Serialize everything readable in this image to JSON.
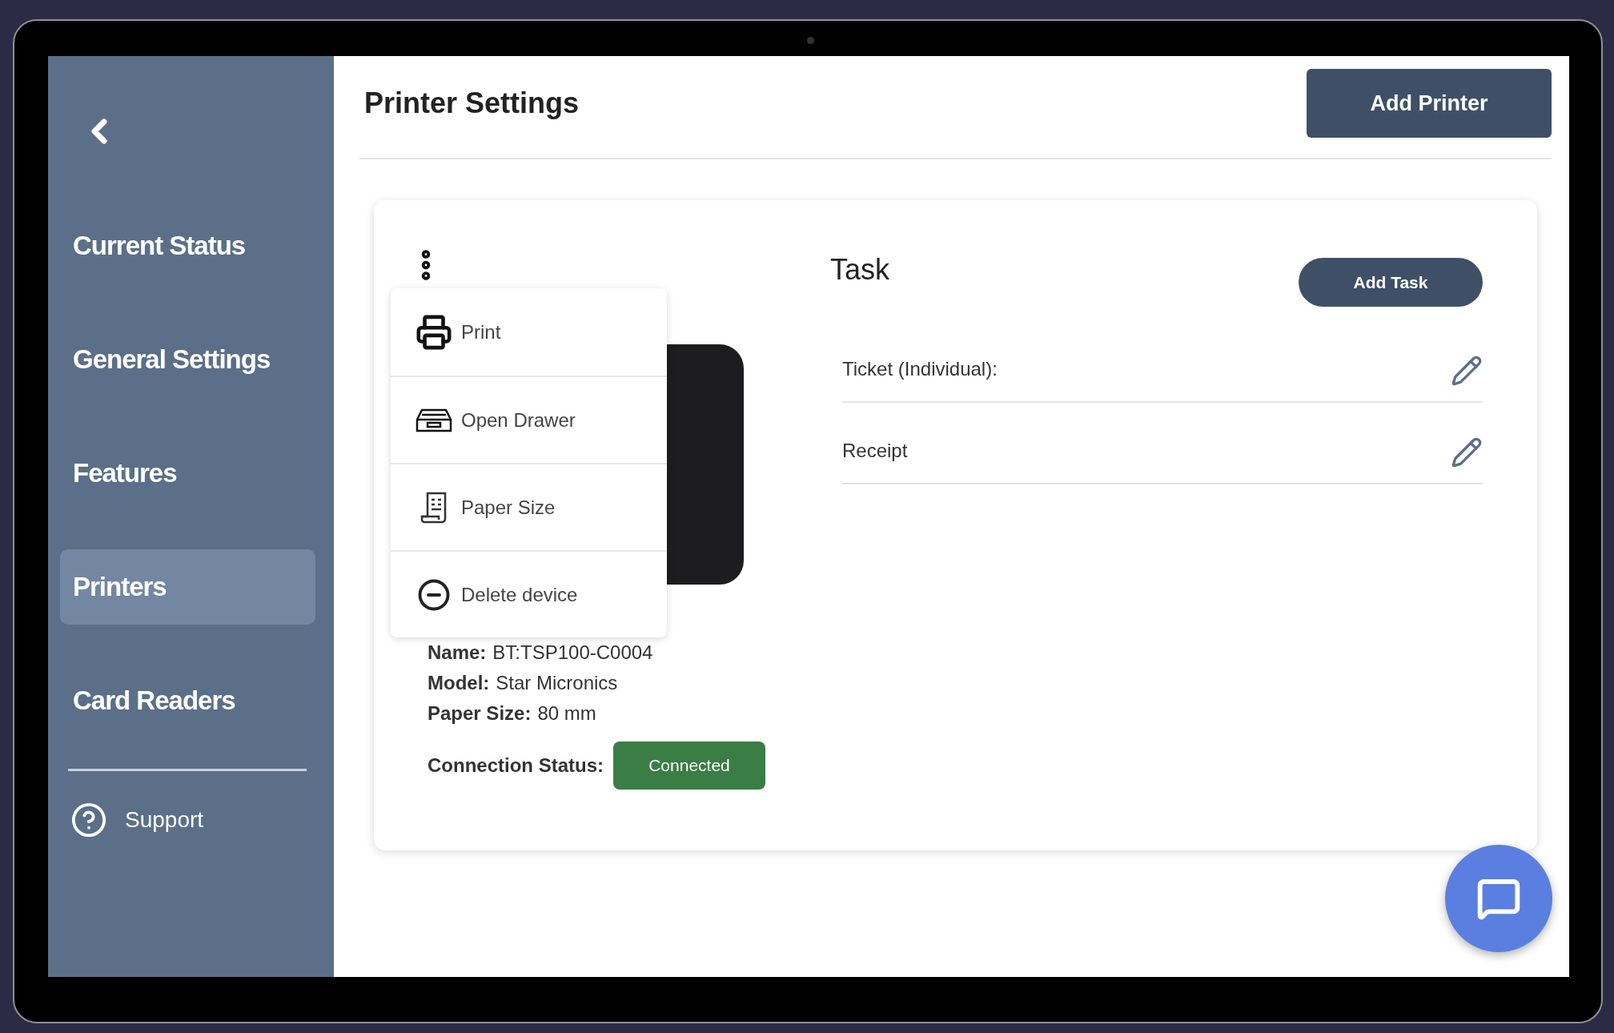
{
  "sidebar": {
    "items": [
      {
        "label": "Current Status",
        "selected": false
      },
      {
        "label": "General Settings",
        "selected": false
      },
      {
        "label": "Features",
        "selected": false
      },
      {
        "label": "Printers",
        "selected": true
      },
      {
        "label": "Card Readers",
        "selected": false
      }
    ],
    "support": "Support"
  },
  "header": {
    "title": "Printer Settings",
    "add_button": "Add Printer"
  },
  "printer": {
    "menu": [
      {
        "label": "Print",
        "kind": "print"
      },
      {
        "label": "Open Drawer",
        "kind": "drawer"
      },
      {
        "label": "Paper Size",
        "kind": "paper"
      },
      {
        "label": "Delete device",
        "kind": "delete"
      }
    ],
    "details": [
      {
        "label": "Name:",
        "value": "BT:TSP100-C0004"
      },
      {
        "label": "Model:",
        "value": "Star Micronics"
      },
      {
        "label": "Paper Size:",
        "value": "80 mm"
      }
    ],
    "connection": {
      "label": "Connection Status:",
      "status": "Connected",
      "connected": true
    }
  },
  "tasks": {
    "title": "Task",
    "add_button": "Add Task",
    "rows": [
      {
        "label": "Ticket (Individual):"
      },
      {
        "label": "Receipt"
      }
    ]
  }
}
